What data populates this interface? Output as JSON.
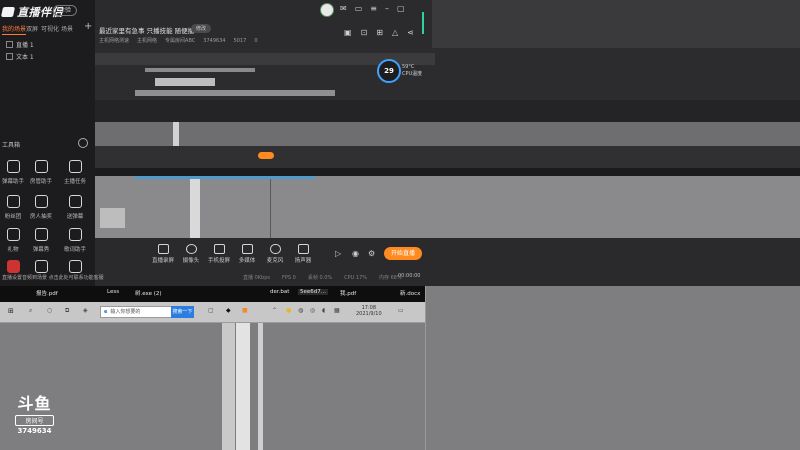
{
  "app": {
    "logo_text": "直播伴侣",
    "version_badge": "体验",
    "tabs": [
      "我的场景",
      "双屏",
      "可视化",
      "场景"
    ],
    "add_label": "+",
    "scenes": [
      "直播 1",
      "文本 1"
    ]
  },
  "room": {
    "title": "最近家里有急事 只播技能 随便播",
    "edit_label": "修改",
    "meta": [
      "主机网络测速",
      "主机网络",
      "专属房间ABC",
      "3749634",
      "5017",
      "0"
    ]
  },
  "cpu": {
    "percent": "29",
    "temp": "59°C",
    "temp_label": "CPU温度"
  },
  "tools": {
    "title": "工具箱",
    "items": [
      "弹幕助手",
      "房管助手",
      "主播任务",
      "粉丝团",
      "房人抽奖",
      "送弹幕",
      "礼物",
      "弹幕秀",
      "歌词助手",
      "新增",
      "分享",
      "更多"
    ]
  },
  "toolbar": {
    "items": [
      "直播录屏",
      "摄像头",
      "手机投屏",
      "多媒体",
      "麦克风",
      "扬声器"
    ],
    "start_live": "开始直播",
    "status": [
      "直播 0Kbps",
      "FPS 0",
      "丢帧 0.0%",
      "CPU 17%",
      "内存 68%"
    ],
    "timer": "00:00:00",
    "notice": "直播设置音频到场景 点击此处可联系功能客服"
  },
  "desktop": {
    "files": [
      "报告.pdf",
      "Less",
      "树.exe (2)",
      "der.bat",
      "5ee6d7...",
      "我.pdf",
      "新.docx"
    ],
    "search_placeholder": "输入你想要的",
    "search_button": "搜索一下",
    "clock_time": "17:08",
    "clock_date": "2021/9/10"
  },
  "watermark": {
    "logo": "斗鱼",
    "tag": "房间号",
    "room_id": "3749634"
  }
}
